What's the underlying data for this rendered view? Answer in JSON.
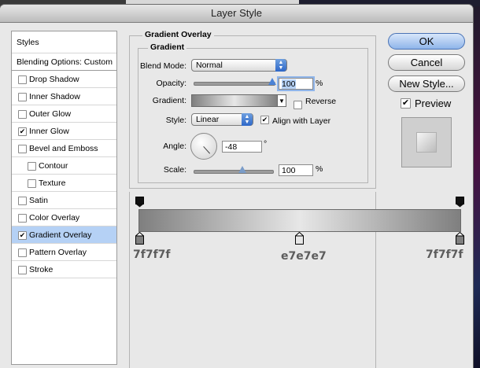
{
  "window": {
    "title": "Layer Style"
  },
  "sidebar": {
    "styles_label": "Styles",
    "blending_label": "Blending Options: Custom",
    "items": [
      {
        "label": "Drop Shadow",
        "checked": false
      },
      {
        "label": "Inner Shadow",
        "checked": false
      },
      {
        "label": "Outer Glow",
        "checked": false
      },
      {
        "label": "Inner Glow",
        "checked": true
      },
      {
        "label": "Bevel and Emboss",
        "checked": false
      },
      {
        "label": "Contour",
        "checked": false
      },
      {
        "label": "Texture",
        "checked": false
      },
      {
        "label": "Satin",
        "checked": false
      },
      {
        "label": "Color Overlay",
        "checked": false
      },
      {
        "label": "Gradient Overlay",
        "checked": true,
        "selected": true
      },
      {
        "label": "Pattern Overlay",
        "checked": false
      },
      {
        "label": "Stroke",
        "checked": false
      }
    ]
  },
  "panel": {
    "title": "Gradient Overlay",
    "subtitle": "Gradient",
    "blend_mode_label": "Blend Mode:",
    "blend_mode_value": "Normal",
    "opacity_label": "Opacity:",
    "opacity_value": "100",
    "opacity_unit": "%",
    "gradient_label": "Gradient:",
    "reverse_label": "Reverse",
    "style_label": "Style:",
    "style_value": "Linear",
    "align_label": "Align with Layer",
    "angle_label": "Angle:",
    "angle_value": "-48",
    "angle_unit": "°",
    "scale_label": "Scale:",
    "scale_value": "100",
    "scale_unit": "%"
  },
  "buttons": {
    "ok": "OK",
    "cancel": "Cancel",
    "new_style": "New Style...",
    "preview": "Preview"
  },
  "gradient_editor": {
    "stops": [
      {
        "hex": "7f7f7f",
        "color": "#7f7f7f"
      },
      {
        "hex": "e7e7e7",
        "color": "#e7e7e7"
      },
      {
        "hex": "7f7f7f",
        "color": "#7f7f7f"
      }
    ]
  },
  "colors": {
    "selection": "#b5d1f5",
    "accent": "#2d67c8"
  }
}
